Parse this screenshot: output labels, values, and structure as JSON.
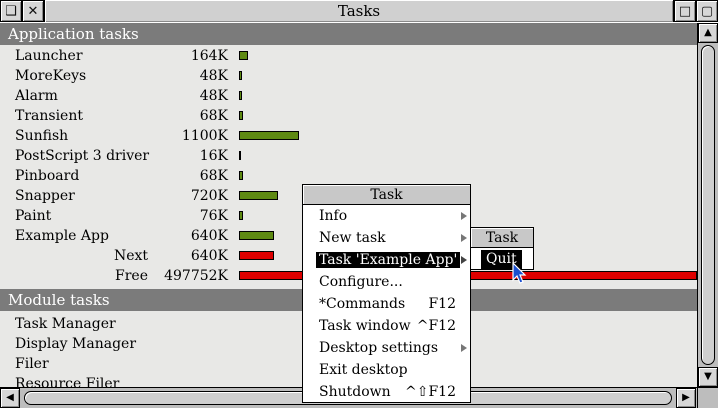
{
  "window": {
    "title": "Tasks",
    "back_icon": "❑",
    "close_icon": "✕",
    "toggle_icon": "▢",
    "iconise_icon": "□"
  },
  "sections": {
    "application": "Application tasks",
    "module": "Module tasks"
  },
  "app_tasks": [
    {
      "name": "Launcher",
      "mem": "164K",
      "bar_fraction": 0.02
    },
    {
      "name": "MoreKeys",
      "mem": "48K",
      "bar_fraction": 0.006
    },
    {
      "name": "Alarm",
      "mem": "48K",
      "bar_fraction": 0.006
    },
    {
      "name": "Transient",
      "mem": "68K",
      "bar_fraction": 0.008
    },
    {
      "name": "Sunfish",
      "mem": "1100K",
      "bar_fraction": 0.13
    },
    {
      "name": "PostScript 3 driver",
      "mem": "16K",
      "bar_fraction": 0.0
    },
    {
      "name": "Pinboard",
      "mem": "68K",
      "bar_fraction": 0.008
    },
    {
      "name": "Snapper",
      "mem": "720K",
      "bar_fraction": 0.085
    },
    {
      "name": "Paint",
      "mem": "76K",
      "bar_fraction": 0.009
    },
    {
      "name": "Example App",
      "mem": "640K",
      "bar_fraction": 0.076
    }
  ],
  "summary": [
    {
      "label": "Next",
      "mem": "640K",
      "bar_fraction": 0.076
    },
    {
      "label": "Free",
      "mem": "497752K",
      "bar_fraction": 1.0
    }
  ],
  "module_tasks": [
    "Task Manager",
    "Display Manager",
    "Filer",
    "Resource Filer"
  ],
  "menu": {
    "title": "Task",
    "items": [
      {
        "label": "Info",
        "shortcut": "",
        "submenu": true
      },
      {
        "label": "New task",
        "shortcut": "",
        "submenu": true
      },
      {
        "label": "Task 'Example App'",
        "shortcut": "",
        "submenu": true
      },
      {
        "label": "Configure...",
        "shortcut": "",
        "submenu": false
      },
      {
        "label": "*Commands",
        "shortcut": "F12",
        "submenu": false
      },
      {
        "label": "Task window",
        "shortcut": "^F12",
        "submenu": false
      },
      {
        "label": "Desktop settings",
        "shortcut": "",
        "submenu": true
      },
      {
        "label": "Exit desktop",
        "shortcut": "",
        "submenu": false
      },
      {
        "label": "Shutdown",
        "shortcut": "^⇧F12",
        "submenu": false
      }
    ]
  },
  "submenu": {
    "title": "Task",
    "item": "Quit"
  },
  "scroll": {
    "up": "▲",
    "down": "▼",
    "left": "◀",
    "right": "▶"
  },
  "colors": {
    "bar": "#5e8a12",
    "bar_red": "#dd0000",
    "section_header": "#7b7b7b",
    "highlight": "#000000"
  }
}
